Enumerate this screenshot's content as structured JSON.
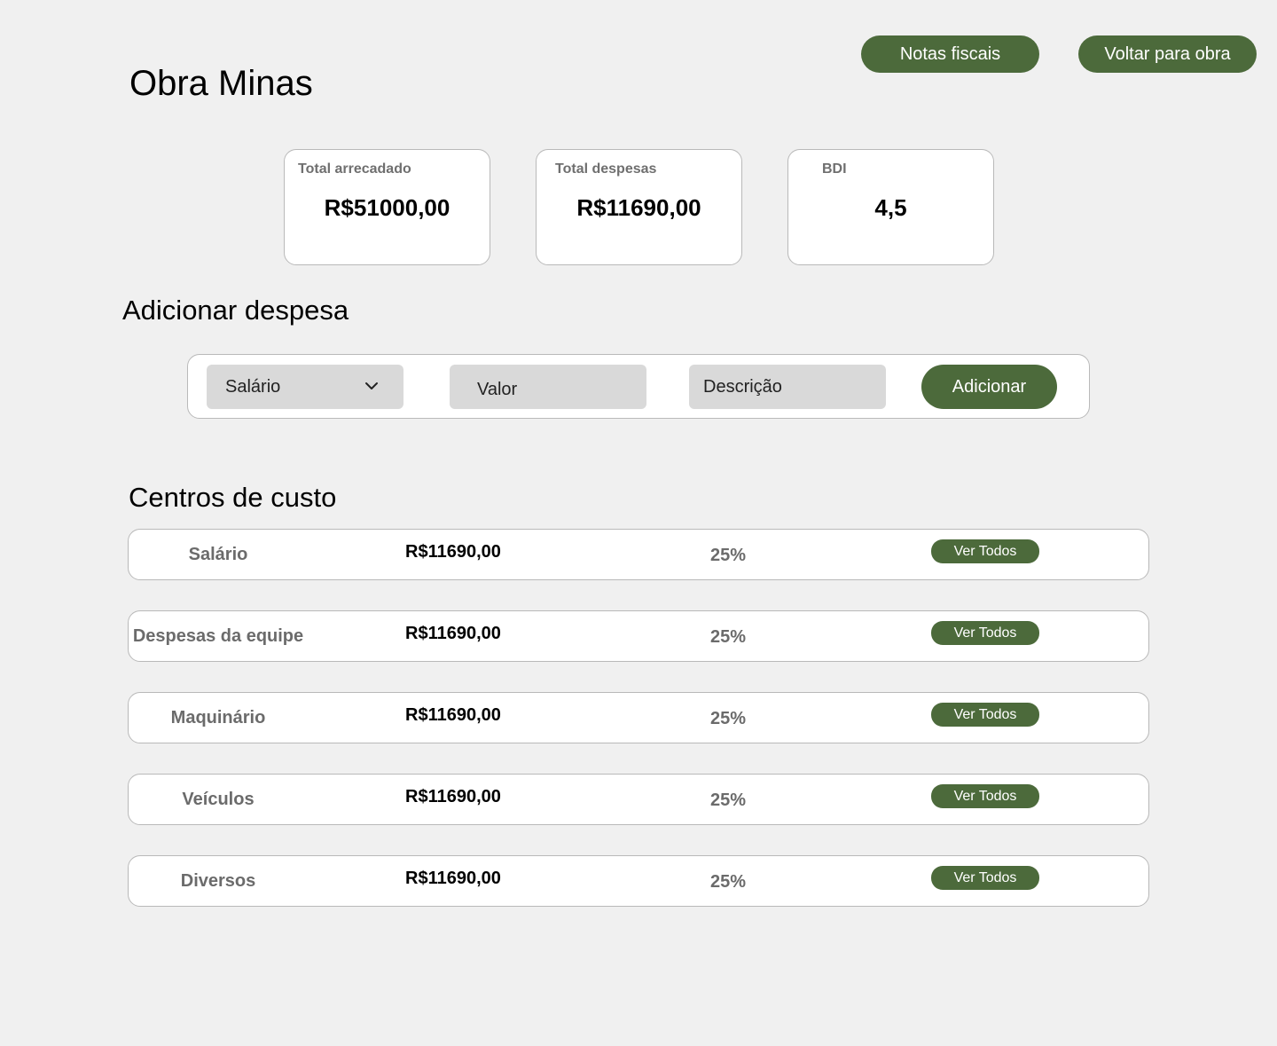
{
  "header": {
    "title": "Obra Minas",
    "notas_label": "Notas fiscais",
    "voltar_label": "Voltar para obra"
  },
  "stats": [
    {
      "label": "Total arrecadado",
      "value": "R$51000,00"
    },
    {
      "label": "Total despesas",
      "value": "R$11690,00"
    },
    {
      "label": "BDI",
      "value": "4,5"
    }
  ],
  "add_expense": {
    "title": "Adicionar despesa",
    "type_selected": "Salário",
    "valor_placeholder": "Valor",
    "descricao_placeholder": "Descrição",
    "submit_label": "Adicionar"
  },
  "cost_centers": {
    "title": "Centros de custo",
    "button_label": "Ver Todos",
    "rows": [
      {
        "name": "Salário",
        "amount": "R$11690,00",
        "percent": "25%"
      },
      {
        "name": "Despesas da equipe",
        "amount": "R$11690,00",
        "percent": "25%"
      },
      {
        "name": "Maquinário",
        "amount": "R$11690,00",
        "percent": "25%"
      },
      {
        "name": "Veículos",
        "amount": "R$11690,00",
        "percent": "25%"
      },
      {
        "name": "Diversos",
        "amount": "R$11690,00",
        "percent": "25%"
      }
    ]
  },
  "icons": {
    "select_chevron": "chevron-down-icon"
  },
  "colors": {
    "accent": "#4c6a3b",
    "background": "#f0f0f0",
    "field": "#d9d9d9"
  }
}
